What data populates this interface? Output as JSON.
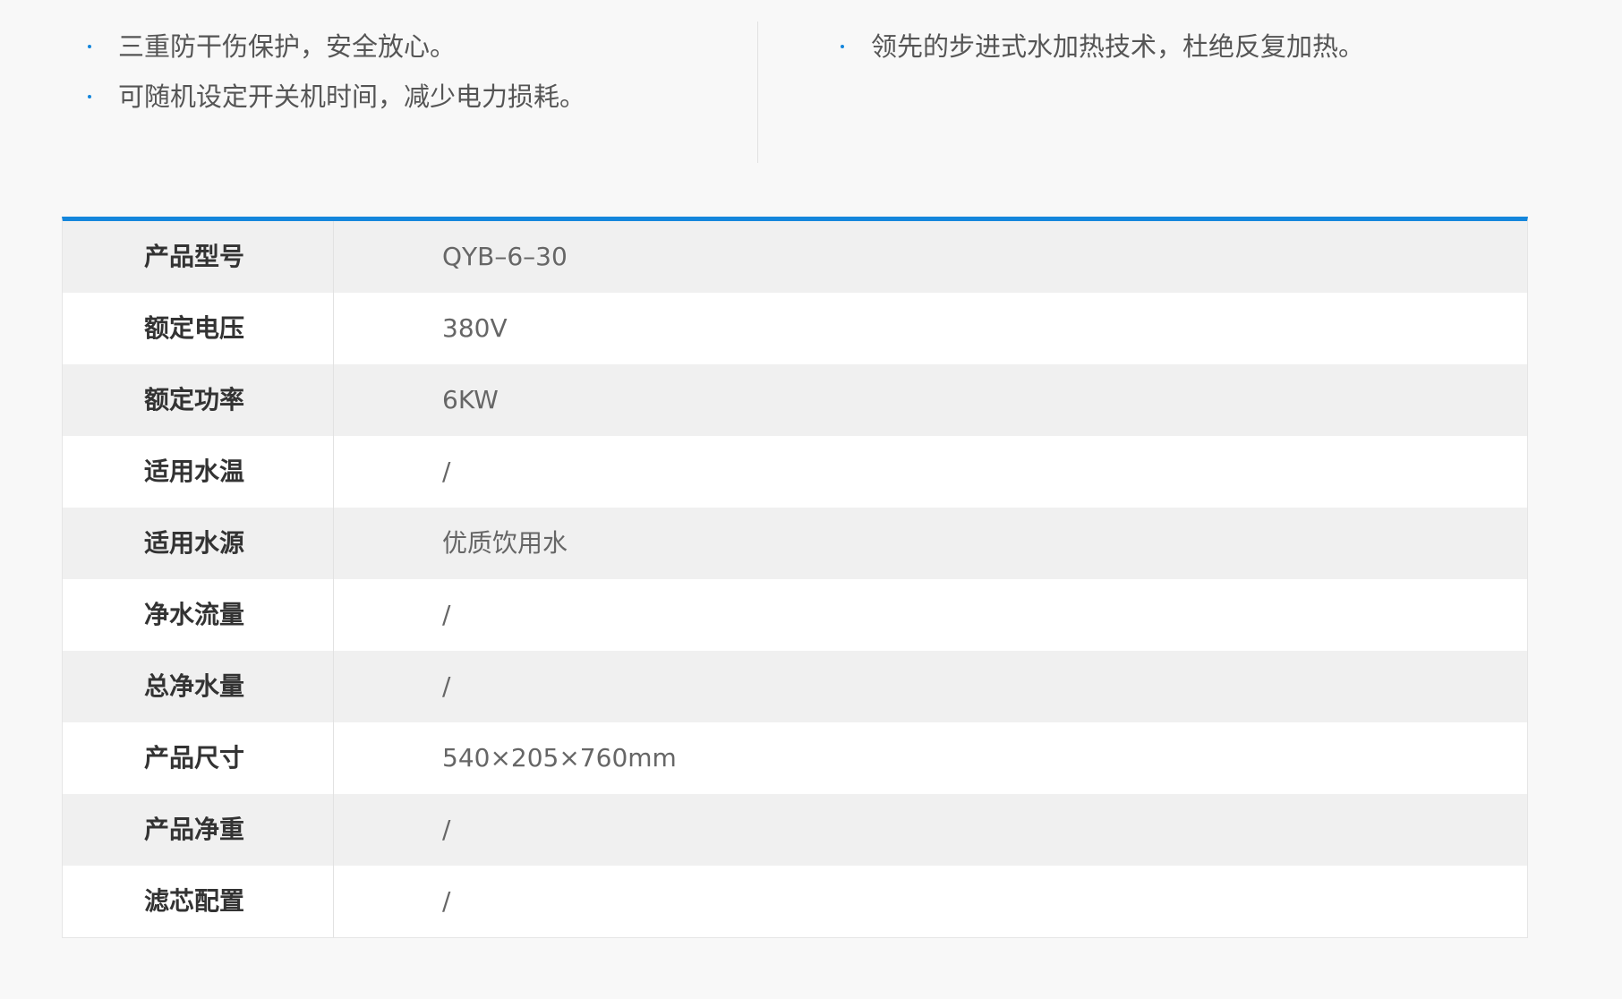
{
  "features": {
    "left": [
      "三重防干伤保护，安全放心。",
      "可随机设定开关机时间，减少电力损耗。"
    ],
    "right": [
      "领先的步进式水加热技术，杜绝反复加热。"
    ]
  },
  "specs": [
    {
      "label": "产品型号",
      "value": "QYB–6–30"
    },
    {
      "label": "额定电压",
      "value": "380V"
    },
    {
      "label": "额定功率",
      "value": "6KW"
    },
    {
      "label": "适用水温",
      "value": "/"
    },
    {
      "label": "适用水源",
      "value": "优质饮用水"
    },
    {
      "label": "净水流量",
      "value": "/"
    },
    {
      "label": "总净水量",
      "value": "/"
    },
    {
      "label": "产品尺寸",
      "value": "540×205×760mm"
    },
    {
      "label": "产品净重",
      "value": "/"
    },
    {
      "label": "滤芯配置",
      "value": "/"
    }
  ],
  "colors": {
    "accent": "#1486dc",
    "row_alt": "#f0f0f0",
    "row": "#ffffff",
    "page_bg": "#f8f8f8"
  },
  "icons": {
    "bullet": "bullet-dot-icon"
  }
}
